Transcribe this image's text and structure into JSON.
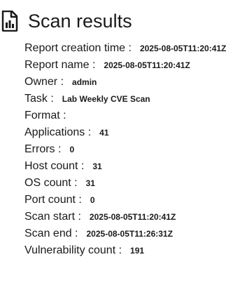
{
  "header": {
    "icon": "document-chart-icon",
    "title": "Scan results"
  },
  "details": [
    {
      "label": "Report creation time :",
      "value": "2025-08-05T11:20:41Z"
    },
    {
      "label": "Report name :",
      "value": "2025-08-05T11:20:41Z"
    },
    {
      "label": "Owner :",
      "value": "admin"
    },
    {
      "label": "Task :",
      "value": "Lab Weekly CVE Scan"
    },
    {
      "label": "Format :",
      "value": ""
    },
    {
      "label": "Applications :",
      "value": "41"
    },
    {
      "label": "Errors :",
      "value": "0"
    },
    {
      "label": "Host count :",
      "value": "31"
    },
    {
      "label": "OS count :",
      "value": "31"
    },
    {
      "label": "Port count :",
      "value": "0"
    },
    {
      "label": "Scan start :",
      "value": "2025-08-05T11:20:41Z"
    },
    {
      "label": "Scan end :",
      "value": "2025-08-05T11:26:31Z"
    },
    {
      "label": "Vulnerability count :",
      "value": "191"
    }
  ]
}
